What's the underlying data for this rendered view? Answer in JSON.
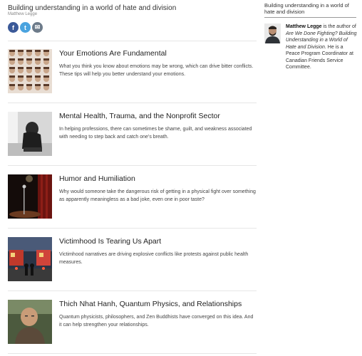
{
  "header": {
    "tagline": "Building understanding in a world of hate and division",
    "author": "Matthew Legge"
  },
  "share": {
    "facebook": "f",
    "twitter": "t",
    "email": "✉"
  },
  "posts": [
    {
      "title": "Your Emotions Are Fundamental",
      "desc": "What you think you know about emotions may be wrong, which can drive bitter conflicts. These tips will help you better understand your emotions.",
      "thumb_icon": "faces-grid-icon"
    },
    {
      "title": "Mental Health, Trauma, and the Nonprofit Sector",
      "desc": "In helping professions, there can sometimes be shame, guilt, and weakness associated with needing to step back and catch one’s breath.",
      "thumb_icon": "sad-person-icon"
    },
    {
      "title": "Humor and Humiliation",
      "desc": "Why would someone take the dangerous risk of getting in a physical fight over something as apparently meaningless as a bad joke, even one in poor taste?",
      "thumb_icon": "stage-microphone-icon"
    },
    {
      "title": "Victimhood Is Tearing Us Apart",
      "desc": "Victimhood narratives are driving explosive conflicts like protests against public health measures.",
      "thumb_icon": "street-protest-icon"
    },
    {
      "title": "Thich Nhat Hanh, Quantum Physics, and Relationships",
      "desc": "Quantum physicists, philosophers, and Zen Buddhists have converged on this idea. And it can help strengthen your relationships.",
      "thumb_icon": "monk-portrait-icon"
    }
  ],
  "sidebar": {
    "subtitle": "Building understanding in a world of hate and division",
    "bio_name": "Matthew Legge",
    "bio_is": " is the author of ",
    "bio_book": "Are We Done Fighting? Building Understanding in a World of Hate and Division.",
    "bio_rest": " He is a Peace Program Coordinator at Canadian Friends Service Committee."
  }
}
